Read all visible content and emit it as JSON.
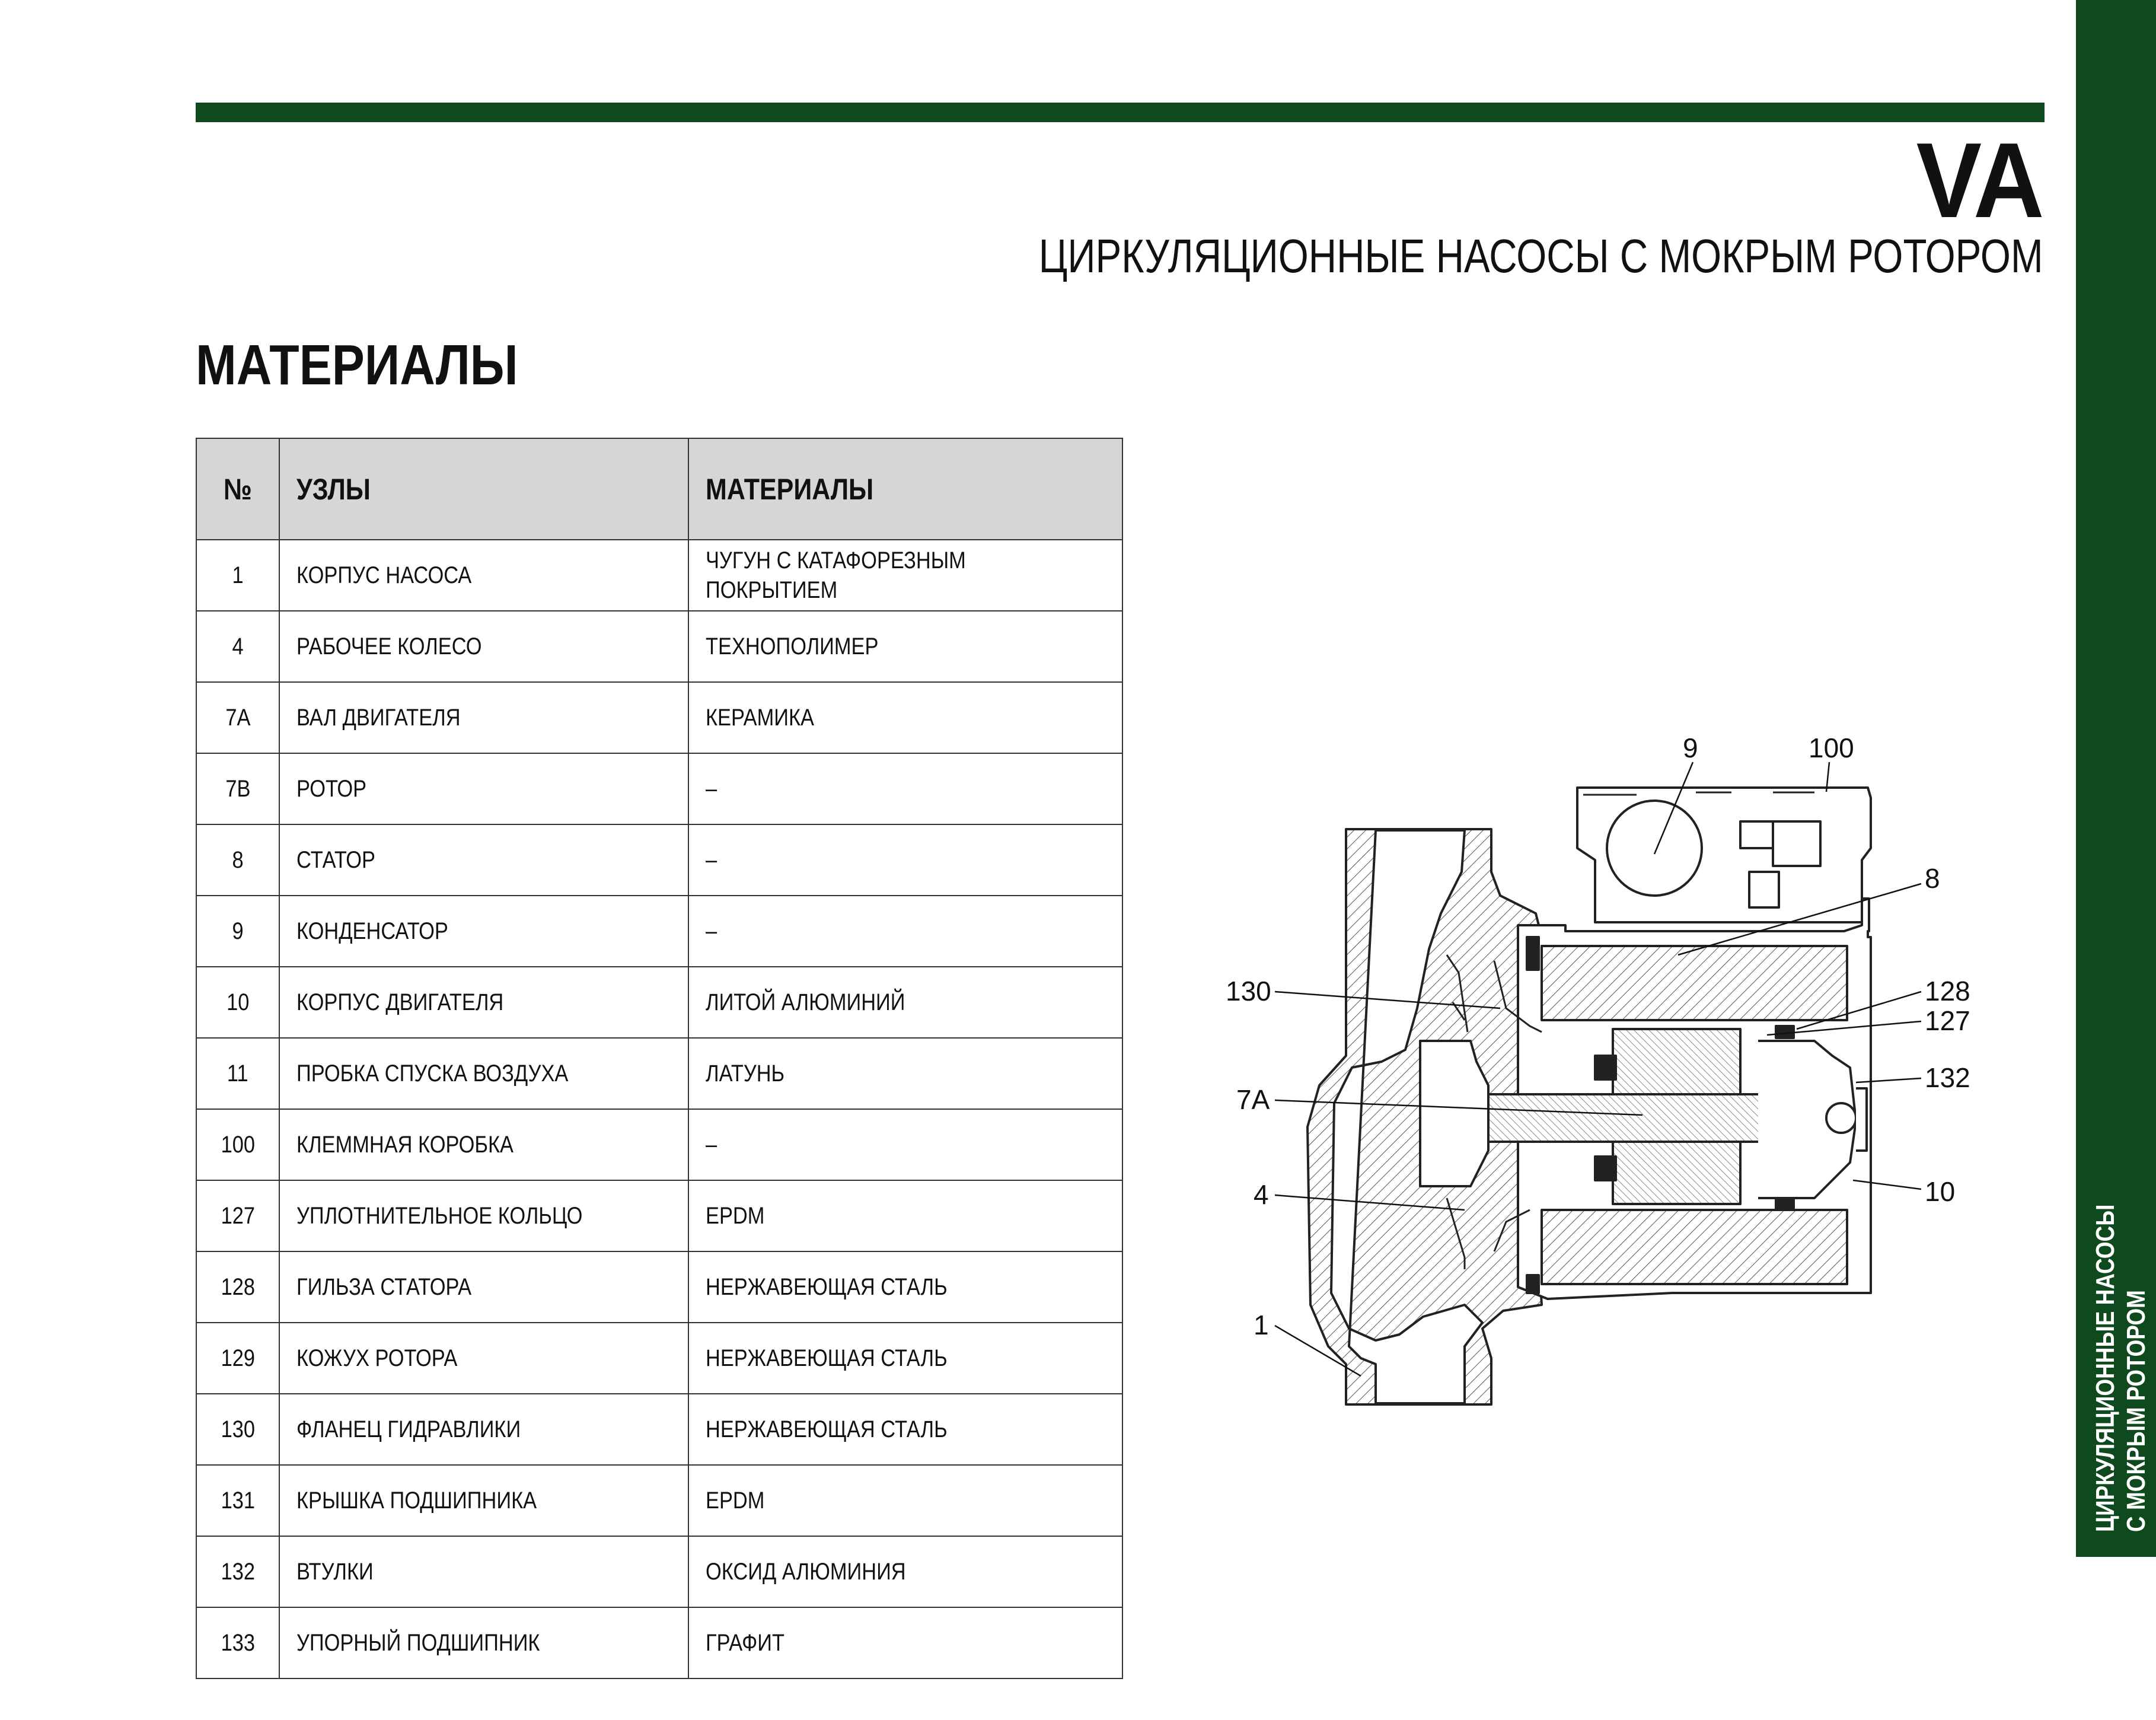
{
  "header": {
    "model_code": "VA",
    "subtitle": "ЦИРКУЛЯЦИОННЫЕ НАСОСЫ С МОКРЫМ РОТОРОМ"
  },
  "section_title": "МАТЕРИАЛЫ",
  "table": {
    "columns": [
      "№",
      "УЗЛЫ",
      "МАТЕРИАЛЫ"
    ],
    "rows": [
      {
        "no": "1",
        "part": "КОРПУС НАСОСА",
        "material_line1": "ЧУГУН С КАТАФОРЕЗНЫМ",
        "material_line2": "ПОКРЫТИЕМ"
      },
      {
        "no": "4",
        "part": "РАБОЧЕЕ КОЛЕСО",
        "material": "ТЕХНОПОЛИМЕР"
      },
      {
        "no": "7A",
        "part": "ВАЛ ДВИГАТЕЛЯ",
        "material": "КЕРАМИКА"
      },
      {
        "no": "7B",
        "part": "РОТОР",
        "material": "–"
      },
      {
        "no": "8",
        "part": "СТАТОР",
        "material": "–"
      },
      {
        "no": "9",
        "part": "КОНДЕНСАТОР",
        "material": "–"
      },
      {
        "no": "10",
        "part": "КОРПУС ДВИГАТЕЛЯ",
        "material": "ЛИТОЙ АЛЮМИНИЙ"
      },
      {
        "no": "11",
        "part": "ПРОБКА СПУСКА ВОЗДУХА",
        "material": "ЛАТУНЬ"
      },
      {
        "no": "100",
        "part": "КЛЕММНАЯ КОРОБКА",
        "material": "–"
      },
      {
        "no": "127",
        "part": "УПЛОТНИТЕЛЬНОЕ КОЛЬЦО",
        "material": "EPDM"
      },
      {
        "no": "128",
        "part": "ГИЛЬЗА СТАТОРА",
        "material": "НЕРЖАВЕЮЩАЯ СТАЛЬ"
      },
      {
        "no": "129",
        "part": "КОЖУХ РОТОРА",
        "material": "НЕРЖАВЕЮЩАЯ СТАЛЬ"
      },
      {
        "no": "130",
        "part": "ФЛАНЕЦ ГИДРАВЛИКИ",
        "material": "НЕРЖАВЕЮЩАЯ СТАЛЬ"
      },
      {
        "no": "131",
        "part": "КРЫШКА ПОДШИПНИКА",
        "material": "EPDM"
      },
      {
        "no": "132",
        "part": "ВТУЛКИ",
        "material": "ОКСИД АЛЮМИНИЯ"
      },
      {
        "no": "133",
        "part": "УПОРНЫЙ ПОДШИПНИК",
        "material": "ГРАФИТ"
      }
    ]
  },
  "diagram": {
    "callouts": [
      "9",
      "100",
      "8",
      "130",
      "128",
      "127",
      "132",
      "7A",
      "10",
      "4",
      "1"
    ]
  },
  "side_tab": {
    "line1": "ЦИРКУЛЯЦИОННЫЕ НАСОСЫ",
    "line2": "С МОКРЫМ РОТОРОМ"
  },
  "colors": {
    "brand_green": "#0f4a1f",
    "table_header_bg": "#d6d6d6"
  }
}
